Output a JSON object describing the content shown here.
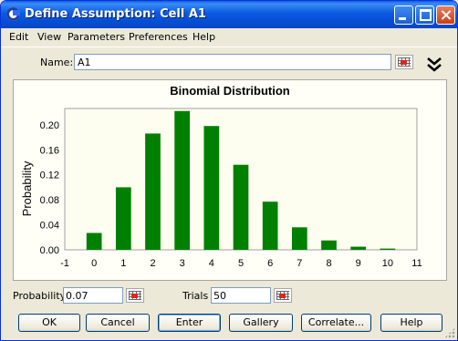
{
  "window": {
    "title": "Define Assumption: Cell A1"
  },
  "menu": [
    "Edit",
    "View",
    "Parameters",
    "Preferences",
    "Help"
  ],
  "name_field": {
    "label": "Name:",
    "value": "A1"
  },
  "chart_data": {
    "type": "bar",
    "title": "Binomial Distribution",
    "xlabel": "",
    "ylabel": "Probability",
    "x_ticks": [
      "-1",
      "0",
      "1",
      "2",
      "3",
      "4",
      "5",
      "6",
      "7",
      "8",
      "9",
      "10",
      "11"
    ],
    "y_ticks": [
      "0.00",
      "0.04",
      "0.08",
      "0.12",
      "0.16",
      "0.20"
    ],
    "categories": [
      0,
      1,
      2,
      3,
      4,
      5,
      6,
      7,
      8,
      9,
      10
    ],
    "values": [
      0.027,
      0.1,
      0.186,
      0.222,
      0.198,
      0.136,
      0.077,
      0.036,
      0.015,
      0.005,
      0.002
    ],
    "xlim": [
      -1,
      11
    ],
    "ylim": [
      0,
      0.226
    ],
    "bar_color": "#008000",
    "plot_background": "#fefef0",
    "grid": false
  },
  "params": {
    "probability": {
      "label": "Probability",
      "value": "0.07"
    },
    "trials": {
      "label": "Trials",
      "value": "50"
    }
  },
  "buttons": {
    "ok": "OK",
    "cancel": "Cancel",
    "enter": "Enter",
    "gallery": "Gallery",
    "correlate": "Correlate...",
    "help": "Help"
  }
}
